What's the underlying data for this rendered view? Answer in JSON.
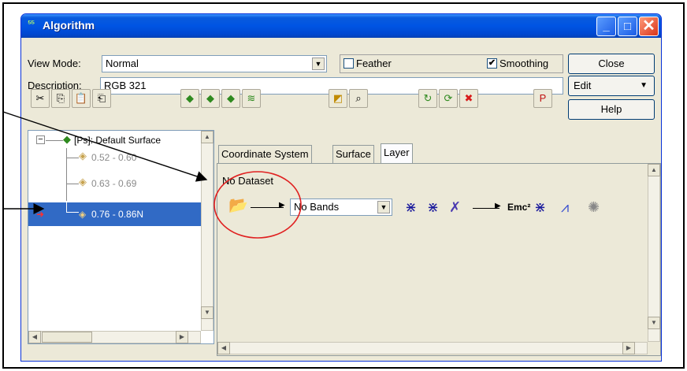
{
  "window": {
    "title": "Algorithm",
    "app_icon": "algorithm-app-icon"
  },
  "title_buttons": {
    "minimize": "_",
    "maximize": "□",
    "close": "✕"
  },
  "view_mode": {
    "label": "View Mode:",
    "value": "Normal"
  },
  "feather": {
    "label": "Feather",
    "checked": false
  },
  "smoothing": {
    "label": "Smoothing",
    "checked": true,
    "check_glyph": "✔"
  },
  "description": {
    "label": "Description:",
    "value": "RGB 321"
  },
  "buttons": {
    "close": "Close",
    "edit": "Edit",
    "help": "Help"
  },
  "toolbar_icons": [
    "cut-icon",
    "copy-icon",
    "paste-icon",
    "paste-special-icon",
    "layer-down-icon",
    "layer-up-icon",
    "layer-move-icon",
    "surface-icon",
    "load-icon",
    "zoom-preview-icon",
    "refresh-icon",
    "auto-refresh-icon",
    "stop-icon",
    "publish-icon"
  ],
  "tree": {
    "root_label": "[Ps]: Default Surface",
    "items": [
      {
        "label": "0.52 - 0.60",
        "disabled": true
      },
      {
        "label": "0.63 - 0.69",
        "disabled": true
      },
      {
        "label": "0.76 - 0.86N",
        "selected": true
      }
    ]
  },
  "tabs": [
    {
      "label": "Coordinate System",
      "active": false
    },
    {
      "label": "Surface",
      "active": false
    },
    {
      "label": "Layer",
      "active": true
    }
  ],
  "layer": {
    "dataset": "No Dataset",
    "bands": {
      "value": "No Bands"
    },
    "formula_glyph": "Emc²",
    "pipeline_icons": [
      "open-folder-icon",
      "filter-icon",
      "transform-icon",
      "formula-icon",
      "filter-icon",
      "histogram-icon",
      "disabled-sunburst-icon"
    ]
  },
  "colors": {
    "title_blue": "#0054e3",
    "selection": "#316ac5",
    "annotation_circle": "#e02020"
  }
}
